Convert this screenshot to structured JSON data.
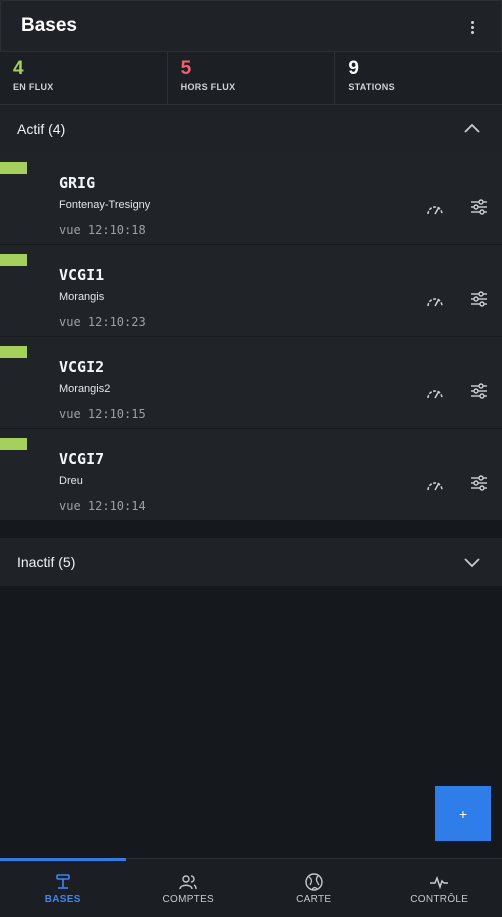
{
  "appbar": {
    "title": "Bases",
    "menu_icon": "more-vertical-icon"
  },
  "stats": [
    {
      "value": "4",
      "label": "EN FLUX",
      "color": "#a5d05c"
    },
    {
      "value": "5",
      "label": "HORS FLUX",
      "color": "#f0606a"
    },
    {
      "value": "9",
      "label": "STATIONS",
      "color": "#ffffff"
    }
  ],
  "sections": {
    "active": {
      "label": "Actif (4)",
      "expanded": true
    },
    "inactive": {
      "label": "Inactif (5)",
      "expanded": false
    }
  },
  "bases": [
    {
      "code": "GRIG",
      "name": "Fontenay-Tresigny",
      "seen": "vue 12:10:18",
      "status_color": "#a5d05c"
    },
    {
      "code": "VCGI1",
      "name": "Morangis",
      "seen": "vue 12:10:23",
      "status_color": "#a5d05c"
    },
    {
      "code": "VCGI2",
      "name": "Morangis2",
      "seen": "vue 12:10:15",
      "status_color": "#a5d05c"
    },
    {
      "code": "VCGI7",
      "name": "Dreu",
      "seen": "vue 12:10:14",
      "status_color": "#a5d05c"
    }
  ],
  "fab": {
    "label": "+"
  },
  "nav": {
    "tabs": [
      {
        "label": "BASES",
        "icon": "base-station-icon",
        "active": true
      },
      {
        "label": "COMPTES",
        "icon": "users-icon",
        "active": false
      },
      {
        "label": "CARTE",
        "icon": "globe-icon",
        "active": false
      },
      {
        "label": "CONTRÔLE",
        "icon": "pulse-icon",
        "active": false
      }
    ]
  }
}
